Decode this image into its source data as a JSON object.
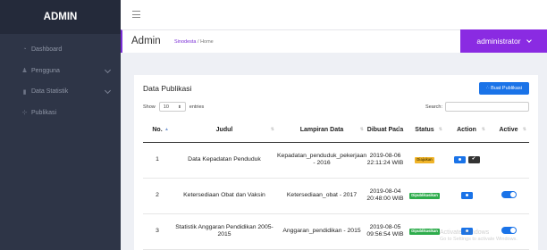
{
  "sidebar": {
    "brand": "ADMIN",
    "items": [
      {
        "label": "Dashboard",
        "icon": "dashboard-icon",
        "has_chevron": false
      },
      {
        "label": "Pengguna",
        "icon": "users-icon",
        "has_chevron": true
      },
      {
        "label": "Data Statistik",
        "icon": "bar-chart-icon",
        "has_chevron": true
      },
      {
        "label": "Publikasi",
        "icon": "publication-icon",
        "has_chevron": false
      }
    ]
  },
  "topbar": {
    "menu_icon": "hamburger-icon"
  },
  "header": {
    "title": "Admin",
    "breadcrumb_link": "Sinodesta",
    "breadcrumb_sep": "/",
    "breadcrumb_current": "Home",
    "user_label": "administrator"
  },
  "card": {
    "title": "Data Publikasi",
    "add_button": "∴ Buat Publikasi",
    "show_label": "Show",
    "entries_value": "10",
    "entries_label": "entries",
    "search_label": "Search:"
  },
  "table": {
    "headers": [
      "No.",
      "Judul",
      "Lampiran Data",
      "Dibuat Pada",
      "Status",
      "Action",
      "Active"
    ],
    "rows": [
      {
        "no": "1",
        "judul": "Data Kepadatan Penduduk",
        "lampiran": "Kepadatan_penduduk_pekerjaan - 2016",
        "dibuat": "2019-08-06 22:11:24 WIB",
        "status": "Diajukan",
        "status_type": "warn"
      },
      {
        "no": "2",
        "judul": "Ketersediaan Obat dan Vaksin",
        "lampiran": "Ketersediaan_obat - 2017",
        "dibuat": "2019-08-04 20:48:00 WIB",
        "status": "Dipublikasikan",
        "status_type": "ok"
      },
      {
        "no": "3",
        "judul": "Statistik Anggaran Pendidikan 2005-2015",
        "lampiran": "Anggaran_pendidikan - 2015",
        "dibuat": "2019-08-05 09:56:54 WIB",
        "status": "Dipublikasikan",
        "status_type": "ok"
      }
    ]
  },
  "watermark": {
    "line1": "Activate Windows",
    "line2": "Go to Settings to activate Windows."
  },
  "colors": {
    "sidebar": "#2e3547",
    "accent": "#8a2be2",
    "primary": "#1a73e8",
    "warning": "#f0b429",
    "success": "#2eac4c"
  }
}
